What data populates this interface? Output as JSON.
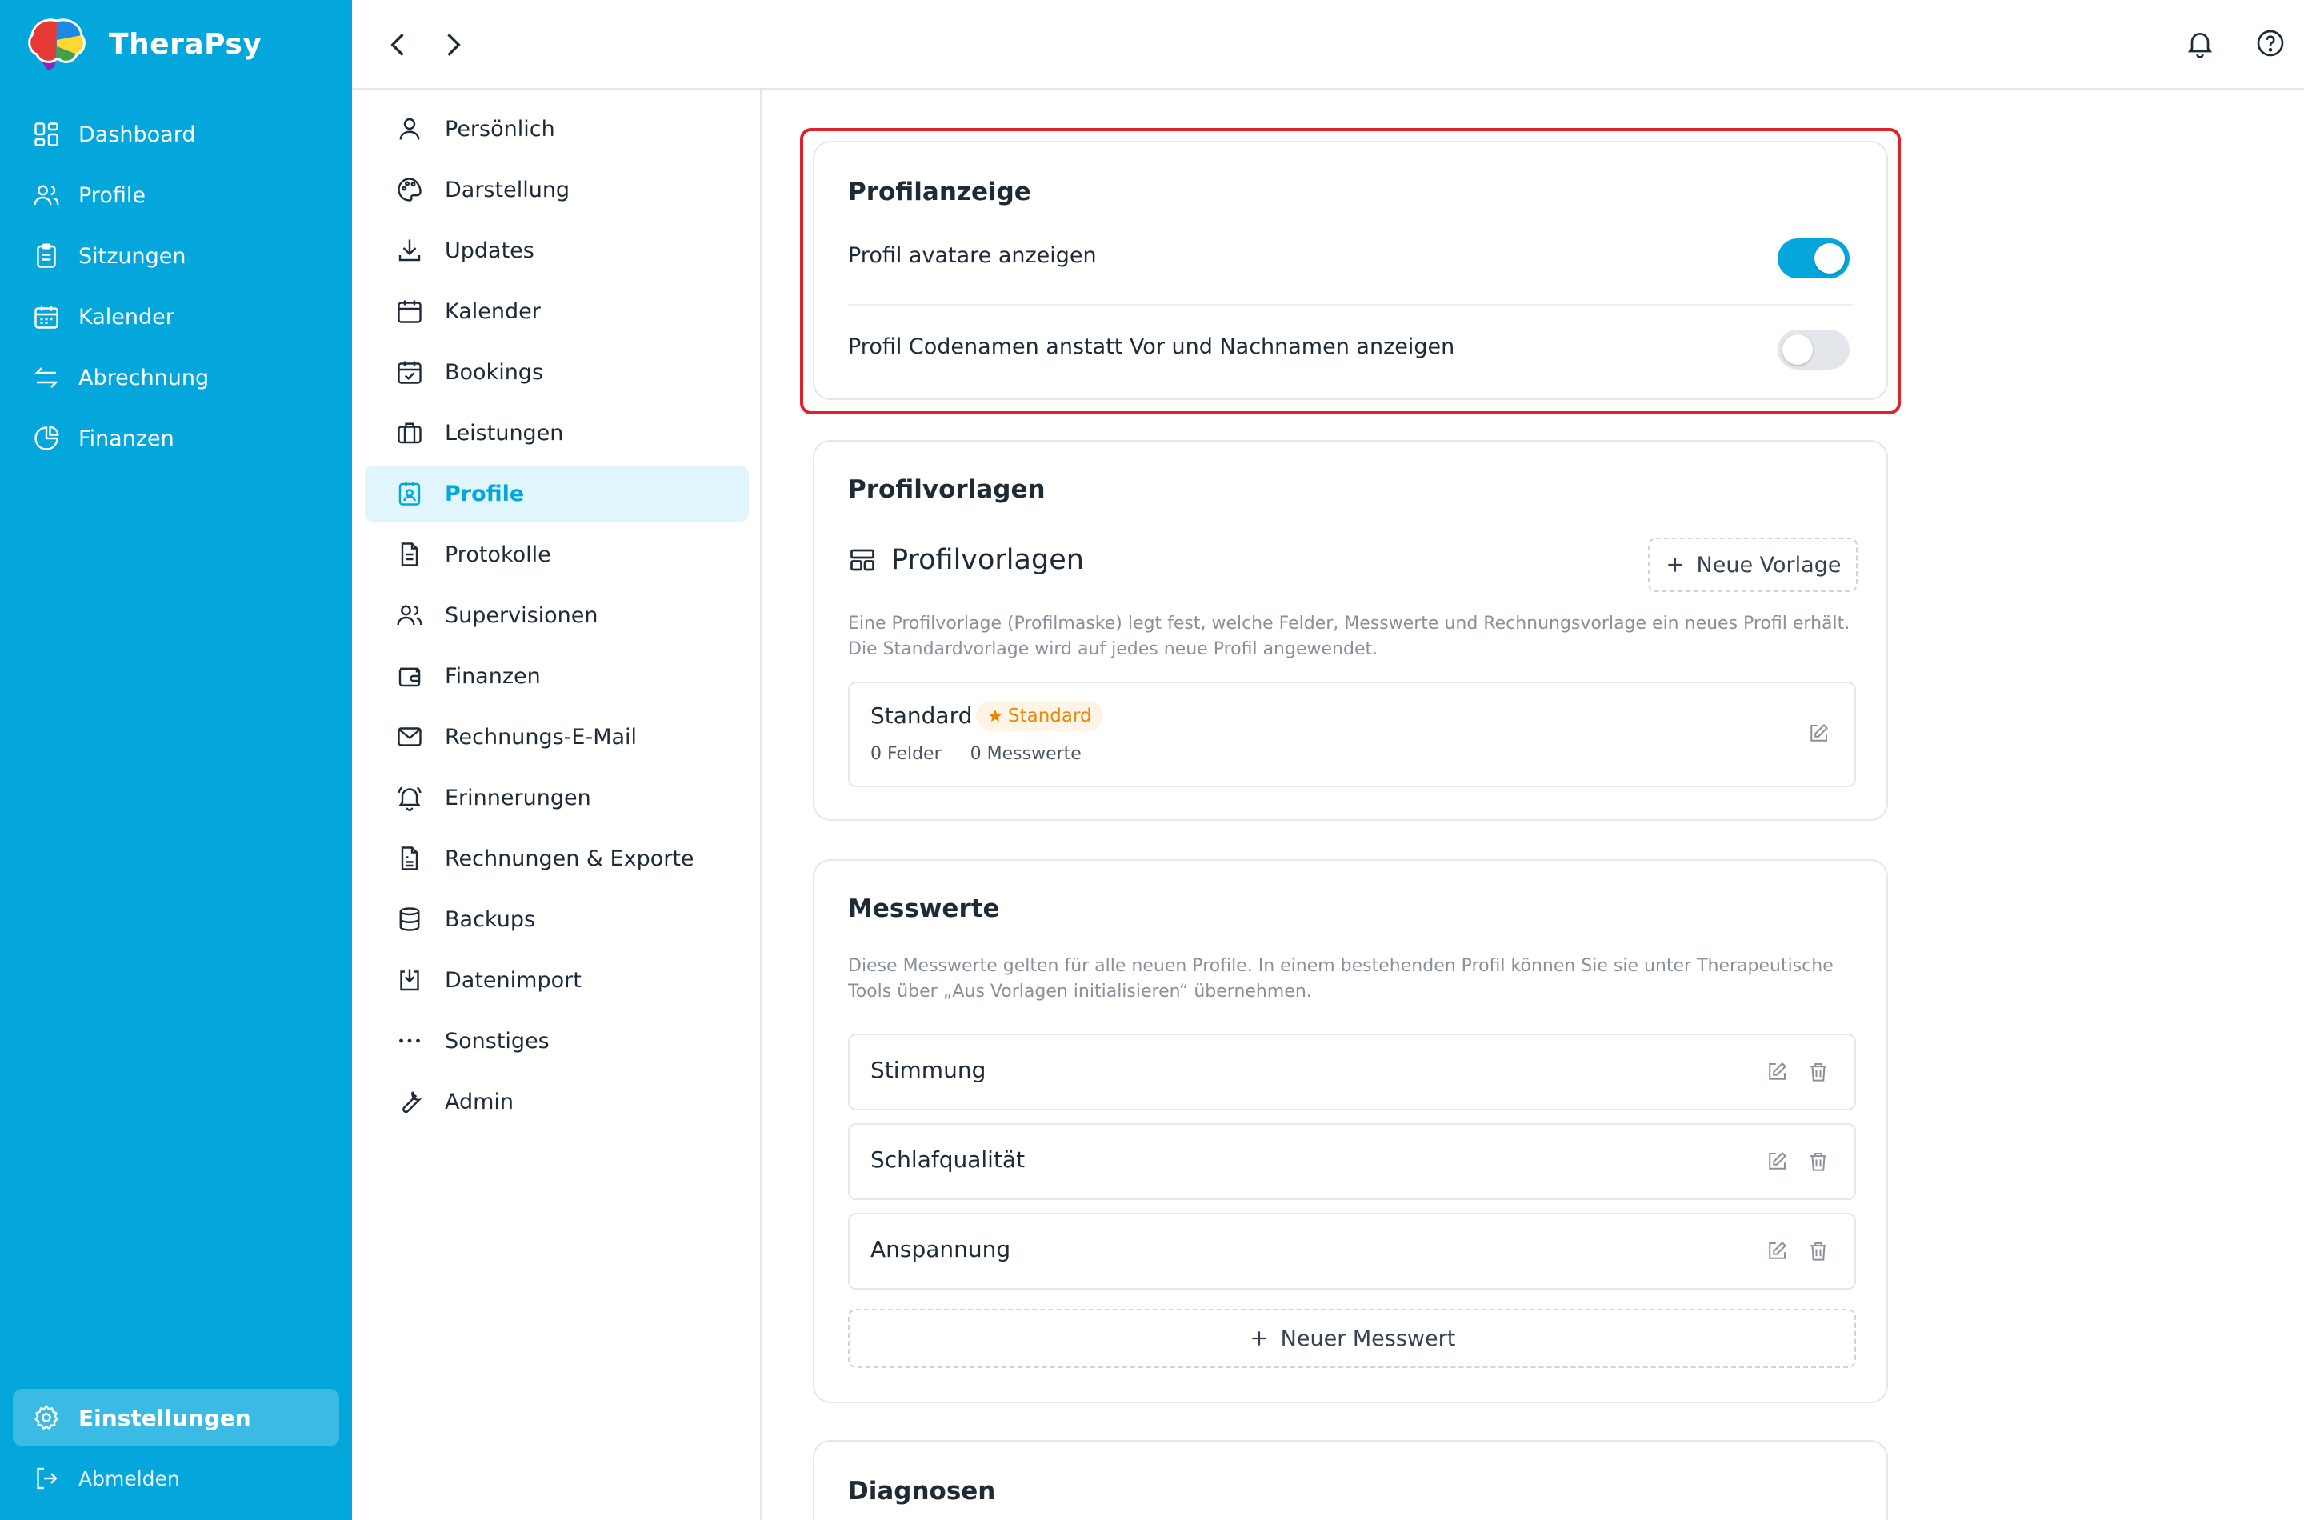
{
  "app": {
    "name": "TheraPsy"
  },
  "sidebar": {
    "items": [
      {
        "label": "Dashboard",
        "icon": "dashboard-icon"
      },
      {
        "label": "Profile",
        "icon": "users-icon"
      },
      {
        "label": "Sitzungen",
        "icon": "clipboard-icon"
      },
      {
        "label": "Kalender",
        "icon": "calendar-icon"
      },
      {
        "label": "Abrechnung",
        "icon": "arrows-exchange-icon"
      },
      {
        "label": "Finanzen",
        "icon": "pie-chart-icon"
      }
    ],
    "settings_label": "Einstellungen",
    "logout_label": "Abmelden"
  },
  "settings_nav": {
    "items": [
      {
        "label": "Persönlich",
        "icon": "user-icon"
      },
      {
        "label": "Darstellung",
        "icon": "palette-icon"
      },
      {
        "label": "Updates",
        "icon": "download-icon"
      },
      {
        "label": "Kalender",
        "icon": "calendar-icon"
      },
      {
        "label": "Bookings",
        "icon": "calendar-check-icon"
      },
      {
        "label": "Leistungen",
        "icon": "briefcase-icon"
      },
      {
        "label": "Profile",
        "icon": "id-badge-icon",
        "active": true
      },
      {
        "label": "Protokolle",
        "icon": "document-icon"
      },
      {
        "label": "Supervisionen",
        "icon": "users-icon"
      },
      {
        "label": "Finanzen",
        "icon": "wallet-icon"
      },
      {
        "label": "Rechnungs-E-Mail",
        "icon": "mail-icon"
      },
      {
        "label": "Erinnerungen",
        "icon": "bell-icon"
      },
      {
        "label": "Rechnungen & Exporte",
        "icon": "invoice-icon"
      },
      {
        "label": "Backups",
        "icon": "database-icon"
      },
      {
        "label": "Datenimport",
        "icon": "import-icon"
      },
      {
        "label": "Sonstiges",
        "icon": "more-icon"
      },
      {
        "label": "Admin",
        "icon": "wrench-icon"
      }
    ]
  },
  "profilanzeige": {
    "title": "Profilanzeige",
    "toggles": [
      {
        "label": "Profil avatare anzeigen",
        "enabled": true
      },
      {
        "label": "Profil Codenamen anstatt Vor und Nachnamen anzeigen",
        "enabled": false
      }
    ]
  },
  "profilvorlagen": {
    "title": "Profilvorlagen",
    "heading": "Profilvorlagen",
    "new_button": "Neue Vorlage",
    "description": "Eine Profilvorlage (Profilmaske) legt fest, welche Felder, Messwerte und Rechnungsvorlage ein neues Profil erhält. Die Standardvorlage wird auf jedes neue Profil angewendet.",
    "templates": [
      {
        "name": "Standard",
        "badge": "Standard",
        "fields": "0 Felder",
        "measures": "0 Messwerte"
      }
    ]
  },
  "messwerte": {
    "title": "Messwerte",
    "description": "Diese Messwerte gelten für alle neuen Profile. In einem bestehenden Profil können Sie sie unter Therapeutische Tools über „Aus Vorlagen initialisieren“ übernehmen.",
    "items": [
      "Stimmung",
      "Schlafqualität",
      "Anspannung"
    ],
    "new_button": "Neuer Messwert"
  },
  "diagnosen": {
    "title": "Diagnosen"
  },
  "colors": {
    "primary": "#04a7db",
    "highlight": "#e0202a",
    "badge": "#e8890c"
  }
}
